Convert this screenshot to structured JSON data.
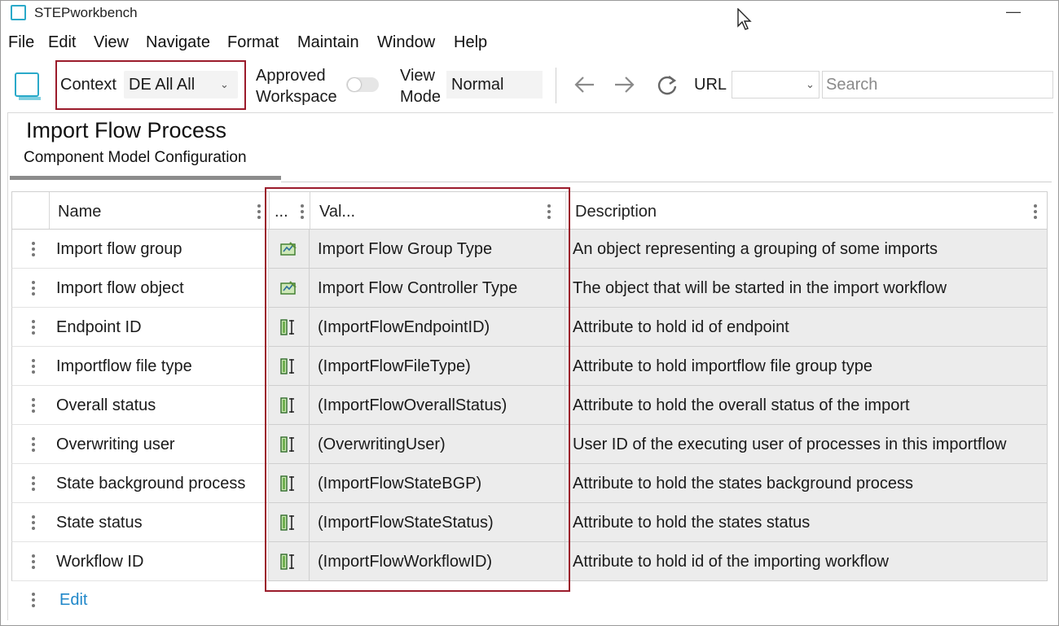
{
  "window": {
    "title": "STEPworkbench",
    "minimize_glyph": "—"
  },
  "menu": [
    "File",
    "Edit",
    "View",
    "Navigate",
    "Format",
    "Maintain",
    "Window",
    "Help"
  ],
  "toolbar": {
    "context_label": "Context",
    "context_value": "DE All All",
    "approved_line1": "Approved",
    "approved_line2": "Workspace",
    "approved_on": false,
    "viewmode_line1": "View",
    "viewmode_line2": "Mode",
    "viewmode_value": "Normal",
    "url_label": "URL",
    "url_value": "",
    "search_placeholder": "Search"
  },
  "page": {
    "title": "Import Flow Process",
    "tab": "Component Model Configuration"
  },
  "table": {
    "columns": [
      "Name",
      "...",
      "Val...",
      "Description"
    ],
    "rows": [
      {
        "name": "Import flow group",
        "icon": "object-type-icon",
        "value": "Import Flow Group Type",
        "description": "An object representing a grouping of some imports"
      },
      {
        "name": "Import flow object",
        "icon": "object-type-icon",
        "value": "Import Flow Controller Type",
        "description": "The object that will be started in the import workflow"
      },
      {
        "name": "Endpoint ID",
        "icon": "attribute-icon",
        "value": "(ImportFlowEndpointID)",
        "description": "Attribute to hold id of endpoint"
      },
      {
        "name": "Importflow file type",
        "icon": "attribute-icon",
        "value": "(ImportFlowFileType)",
        "description": "Attribute to hold importflow file group type"
      },
      {
        "name": "Overall status",
        "icon": "attribute-icon",
        "value": "(ImportFlowOverallStatus)",
        "description": "Attribute to hold the overall status of the import"
      },
      {
        "name": "Overwriting user",
        "icon": "attribute-icon",
        "value": "(OverwritingUser)",
        "description": "User ID of the executing user of processes in this importflow"
      },
      {
        "name": "State background process",
        "icon": "attribute-icon",
        "value": "(ImportFlowStateBGP)",
        "description": "Attribute to hold the states background process"
      },
      {
        "name": "State status",
        "icon": "attribute-icon",
        "value": "(ImportFlowStateStatus)",
        "description": "Attribute to hold the states status"
      },
      {
        "name": "Workflow ID",
        "icon": "attribute-icon",
        "value": "(ImportFlowWorkflowID)",
        "description": "Attribute to hold id of the importing workflow"
      }
    ],
    "edit_label": "Edit"
  },
  "colors": {
    "highlight": "#9b1b2b",
    "accent": "#2aa9c9",
    "link": "#1f87c9"
  }
}
